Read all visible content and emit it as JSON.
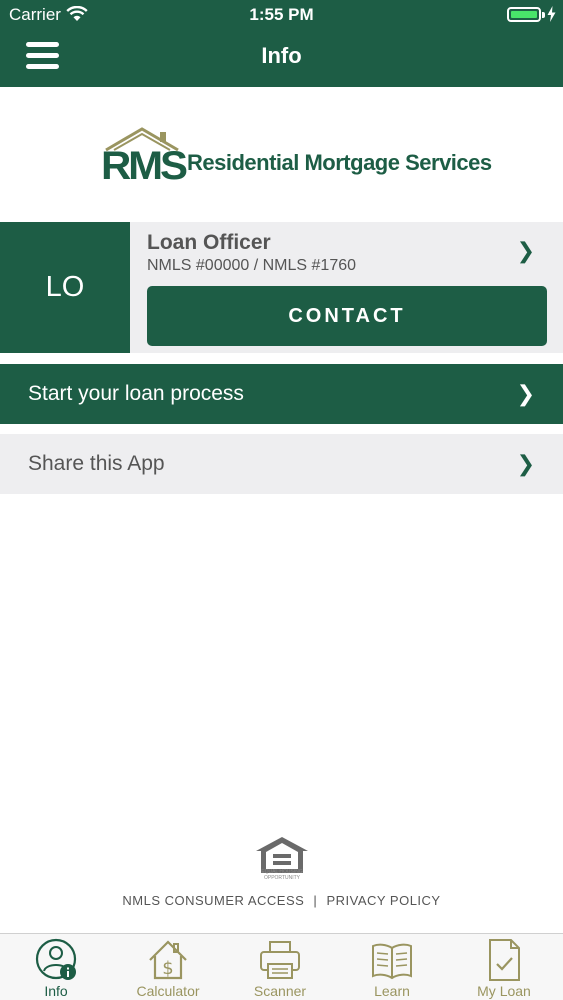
{
  "status_bar": {
    "carrier": "Carrier",
    "time": "1:55 PM"
  },
  "nav": {
    "title": "Info"
  },
  "logo": {
    "letters": "RMS",
    "company_name": "Residential Mortgage Services"
  },
  "loan_officer": {
    "initials": "LO",
    "name": "Loan Officer",
    "nmls": "NMLS #00000 / NMLS #1760",
    "contact_label": "CONTACT"
  },
  "menu_rows": [
    {
      "label": "Start your loan process"
    },
    {
      "label": "Share this App"
    }
  ],
  "footer": {
    "eho_text": "EQUAL HOUSING OPPORTUNITY",
    "nmls_link": "NMLS CONSUMER ACCESS",
    "separator": "|",
    "privacy_link": "PRIVACY POLICY"
  },
  "tabs": [
    {
      "label": "Info",
      "icon": "person-info-icon",
      "active": true
    },
    {
      "label": "Calculator",
      "icon": "house-dollar-icon",
      "active": false
    },
    {
      "label": "Scanner",
      "icon": "printer-icon",
      "active": false
    },
    {
      "label": "Learn",
      "icon": "open-book-icon",
      "active": false
    },
    {
      "label": "My Loan",
      "icon": "document-check-icon",
      "active": false
    }
  ],
  "colors": {
    "brand_green": "#1d5d45",
    "tab_inactive": "#9a9560",
    "row_gray": "#eeeef0"
  }
}
